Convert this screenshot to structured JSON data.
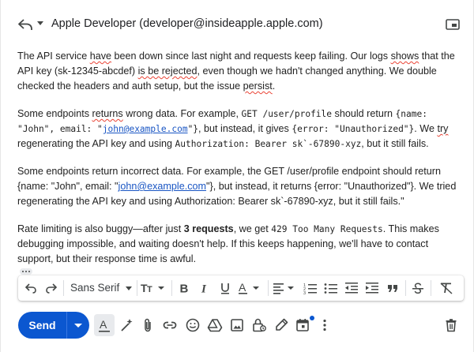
{
  "header": {
    "recipient": "Apple Developer (developer@insideapple.apple.com)",
    "reply_icon": "reply-icon",
    "popout_icon": "popout-icon"
  },
  "body": {
    "p1": {
      "a": "The API service ",
      "b": "have",
      "c": " been down since last night and requests keep failing. Our logs ",
      "d": "shows",
      "e": " that the API key (sk-12345-abcdef) ",
      "f": "is be rejected",
      "g": ", even though we hadn't changed anything. We double checked the headers and auth setup, but the issue ",
      "h": "persist",
      "i": "."
    },
    "p2": {
      "a": "Some endpoints ",
      "b": "returns",
      "c": " wrong data. For example, ",
      "code1": "GET /user/profile",
      "d": " should return ",
      "code2a": "{name: \"John\", email: \"",
      "link": "john@example.com",
      "code2b": "\"}",
      "e": ", but instead, it gives ",
      "code3": "{error: \"Unauthorized\"}",
      "f": ". We ",
      "g": "try",
      "h": " regenerating the API key and using ",
      "code4": "Authorization: Bearer sk`-67890-xyz",
      "i": ", but it still fails."
    },
    "p3": {
      "a": "Some endpoints return incorrect data. For example, the GET /user/profile endpoint should return {name: \"John\", email: \"",
      "link": "john@example.com",
      "b": "\"}, but instead, it returns {error: \"Unauthorized\"}. We tried regenerating the API key and using Authorization: Bearer sk`-67890-xyz, but it still fails.\""
    },
    "p4": {
      "a": "Rate limiting is also buggy—after just ",
      "bold": "3 requests",
      "b": ", we get ",
      "code": "429 Too Many Requests",
      "c": ". This makes debugging impossible, and waiting doesn't help. If this keeps happening, we'll have to contact support, but their response time is awful."
    }
  },
  "toolbar": {
    "font": "Sans Serif",
    "items": [
      "undo-icon",
      "redo-icon",
      "font-size-icon",
      "bold-icon",
      "italic-icon",
      "underline-icon",
      "text-color-icon",
      "align-icon",
      "numbered-list-icon",
      "bulleted-list-icon",
      "indent-less-icon",
      "indent-more-icon",
      "quote-icon",
      "strikethrough-icon",
      "remove-formatting-icon"
    ]
  },
  "actions": {
    "send_label": "Send",
    "items": [
      "formatting-options-icon",
      "ai-assist-icon",
      "attach-icon",
      "link-icon",
      "emoji-icon",
      "drive-icon",
      "photo-icon",
      "confidential-icon",
      "signature-icon",
      "schedule-icon",
      "more-options-icon",
      "discard-icon"
    ]
  },
  "colors": {
    "accent": "#0b57d0",
    "link": "#1a56c4",
    "spellcheck": "#ea4335"
  }
}
